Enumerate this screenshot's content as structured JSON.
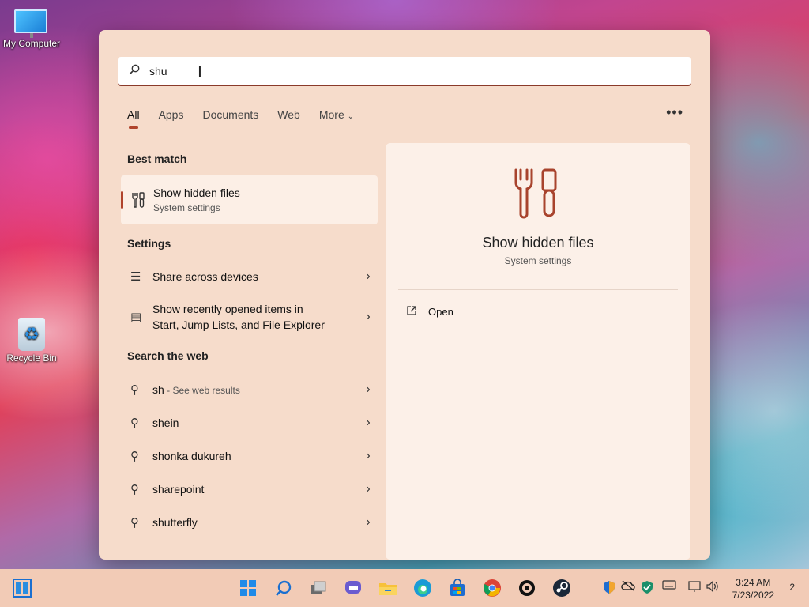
{
  "desktop": {
    "icons": [
      {
        "label": "My Computer"
      },
      {
        "label": "Recycle Bin"
      }
    ]
  },
  "search": {
    "value": "shu",
    "placeholder": ""
  },
  "tabs": [
    "All",
    "Apps",
    "Documents",
    "Web",
    "More"
  ],
  "sections": {
    "best_match": "Best match",
    "settings": "Settings",
    "search_web": "Search the web"
  },
  "best_match": {
    "title": "Show hidden files",
    "subtitle": "System settings"
  },
  "settings_items": [
    {
      "label": "Share across devices"
    },
    {
      "label_line1": "Show recently opened items in",
      "label_line2": "Start, Jump Lists, and File Explorer"
    }
  ],
  "web_items": [
    {
      "label": "sh",
      "suffix": " - See web results"
    },
    {
      "label": "shein"
    },
    {
      "label": "shonka dukureh"
    },
    {
      "label": "sharepoint"
    },
    {
      "label": "shutterfly"
    }
  ],
  "preview": {
    "title": "Show hidden files",
    "subtitle": "System settings",
    "action": "Open"
  },
  "taskbar": {
    "time": "3:24 AM",
    "date": "7/23/2022",
    "notifications": "2"
  },
  "colors": {
    "accent": "#b0442c",
    "panel": "#f6dccb",
    "taskbar": "#f2cbb6"
  }
}
